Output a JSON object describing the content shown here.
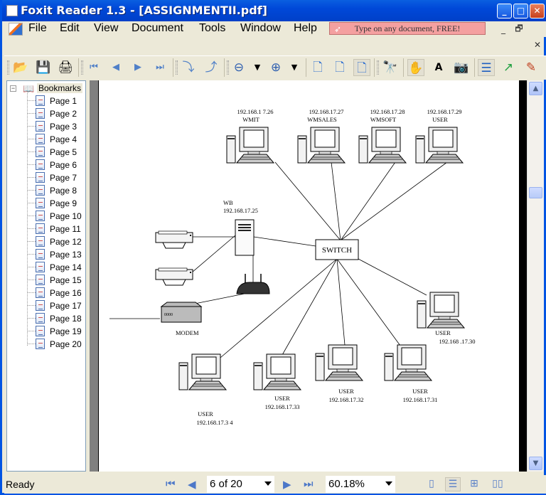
{
  "window": {
    "title": "Foxit Reader 1.3 - [ASSIGNMENTII.pdf]",
    "minimize": "_",
    "maximize": "□",
    "close": "✕"
  },
  "menu": {
    "items": [
      "File",
      "Edit",
      "View",
      "Document",
      "Tools",
      "Window",
      "Help"
    ],
    "promo": "Type on any document, FREE!",
    "mdi_minimize": "_",
    "mdi_restore": "🗗",
    "mdi_close": "✕"
  },
  "toolbar": {
    "buttons": [
      {
        "name": "open",
        "icon": "folder-open-icon",
        "glyph": "📂"
      },
      {
        "name": "save",
        "icon": "floppy-icon",
        "glyph": "💾"
      },
      {
        "name": "print",
        "icon": "printer-icon",
        "glyph": "🖨"
      },
      {
        "name": "first-page",
        "icon": "first-page-icon",
        "glyph": "⏮"
      },
      {
        "name": "prev-page",
        "icon": "prev-page-icon",
        "glyph": "◀"
      },
      {
        "name": "next-page",
        "icon": "next-page-icon",
        "glyph": "▶"
      },
      {
        "name": "last-page",
        "icon": "last-page-icon",
        "glyph": "⏭"
      },
      {
        "name": "rotate-cw",
        "icon": "rotate-cw-icon",
        "glyph": "⤵"
      },
      {
        "name": "rotate-ccw",
        "icon": "rotate-ccw-icon",
        "glyph": "⤴"
      },
      {
        "name": "zoom-out",
        "icon": "zoom-out-icon",
        "glyph": "⊖"
      },
      {
        "name": "zoom-out-menu",
        "icon": "dropdown-icon",
        "glyph": "▼"
      },
      {
        "name": "zoom-in",
        "icon": "zoom-in-icon",
        "glyph": "⊕"
      },
      {
        "name": "zoom-in-menu",
        "icon": "dropdown-icon",
        "glyph": "▼"
      },
      {
        "name": "actual-size",
        "icon": "page-icon",
        "glyph": "🗋"
      },
      {
        "name": "fit-page",
        "icon": "fit-page-icon",
        "glyph": "🗋"
      },
      {
        "name": "fit-width",
        "icon": "fit-width-icon",
        "glyph": "🗋"
      },
      {
        "name": "find",
        "icon": "binoculars-icon",
        "glyph": "🔭"
      },
      {
        "name": "hand",
        "icon": "hand-icon",
        "glyph": "✋"
      },
      {
        "name": "select-text",
        "icon": "select-text-icon",
        "glyph": "A"
      },
      {
        "name": "snapshot",
        "icon": "camera-icon",
        "glyph": "📷"
      },
      {
        "name": "bookmarks-panel",
        "icon": "bookmarks-panel-icon",
        "glyph": "☰"
      },
      {
        "name": "export",
        "icon": "export-icon",
        "glyph": "↗"
      },
      {
        "name": "typewriter",
        "icon": "typewriter-icon",
        "glyph": "✎"
      }
    ]
  },
  "bookmarks": {
    "root": "Bookmarks",
    "items": [
      "Page 1",
      "Page 2",
      "Page 3",
      "Page 4",
      "Page 5",
      "Page 6",
      "Page 7",
      "Page 8",
      "Page 9",
      "Page 10",
      "Page 11",
      "Page 12",
      "Page 13",
      "Page 14",
      "Page 15",
      "Page 16",
      "Page 17",
      "Page 18",
      "Page 19",
      "Page 20"
    ]
  },
  "diagram": {
    "switch_label": "SWITCH",
    "server": {
      "name": "WB",
      "ip": "192.168.17.25"
    },
    "modem_label": "MODEM",
    "top_pcs": [
      {
        "ip": "192.168.1 7.26",
        "name": "WMIT"
      },
      {
        "ip": "192.168.17.27",
        "name": "WMSALES"
      },
      {
        "ip": "192.168.17.28",
        "name": "WMSOFT"
      },
      {
        "ip": "192.168.17.29",
        "name": "USER"
      }
    ],
    "bottom_pcs": [
      {
        "name": "USER",
        "ip": "192.168.17.3 4"
      },
      {
        "name": "USER",
        "ip": "192.168.17.33"
      },
      {
        "name": "USER",
        "ip": "192.168.17.32"
      },
      {
        "name": "USER",
        "ip": "192.168.17.31"
      },
      {
        "name": "USER",
        "ip": "192.168 .17.30"
      }
    ]
  },
  "status": {
    "text": "Ready",
    "page": "6 of 20",
    "zoom": "60.18%"
  }
}
